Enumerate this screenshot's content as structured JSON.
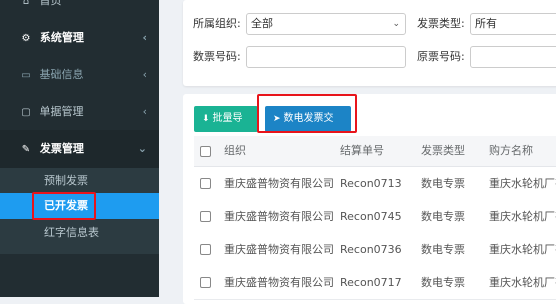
{
  "sidebar": {
    "top_item": "首页",
    "items": [
      {
        "label": "系统管理",
        "icon": "gear-icon"
      },
      {
        "label": "基础信息",
        "icon": "id-card-icon"
      },
      {
        "label": "单据管理",
        "icon": "document-icon"
      },
      {
        "label": "发票管理",
        "icon": "pen-icon"
      }
    ],
    "sub_items": [
      "预制发票",
      "已开发票",
      "红字信息表"
    ],
    "active_sub": "已开发票"
  },
  "filters": {
    "org_label": "所属组织:",
    "org_value": "全部",
    "invoice_type_label": "发票类型:",
    "invoice_type_value": "所有",
    "digital_no_label": "数票号码:",
    "digital_no_value": "",
    "original_no_label": "原票号码:",
    "original_no_value": ""
  },
  "toolbar": {
    "export_label": "批量导出",
    "deliver_label": "数电发票交付"
  },
  "table": {
    "columns": [
      "组织",
      "结算单号",
      "发票类型",
      "购方名称"
    ],
    "rows": [
      {
        "org": "重庆盛普物资有限公司",
        "settle_no": "Recon0713",
        "type": "数电专票",
        "buyer": "重庆水轮机厂有限"
      },
      {
        "org": "重庆盛普物资有限公司",
        "settle_no": "Recon0745",
        "type": "数电专票",
        "buyer": "重庆水轮机厂有限"
      },
      {
        "org": "重庆盛普物资有限公司",
        "settle_no": "Recon0736",
        "type": "数电专票",
        "buyer": "重庆水轮机厂有限"
      },
      {
        "org": "重庆盛普物资有限公司",
        "settle_no": "Recon0717",
        "type": "数电专票",
        "buyer": "重庆水轮机厂有限"
      }
    ]
  },
  "colors": {
    "sidebar_bg": "#222d32",
    "active_item": "#1e9cf0",
    "highlight_border": "#e8141b",
    "export_button": "#1ab394",
    "deliver_button": "#1c84c6"
  }
}
